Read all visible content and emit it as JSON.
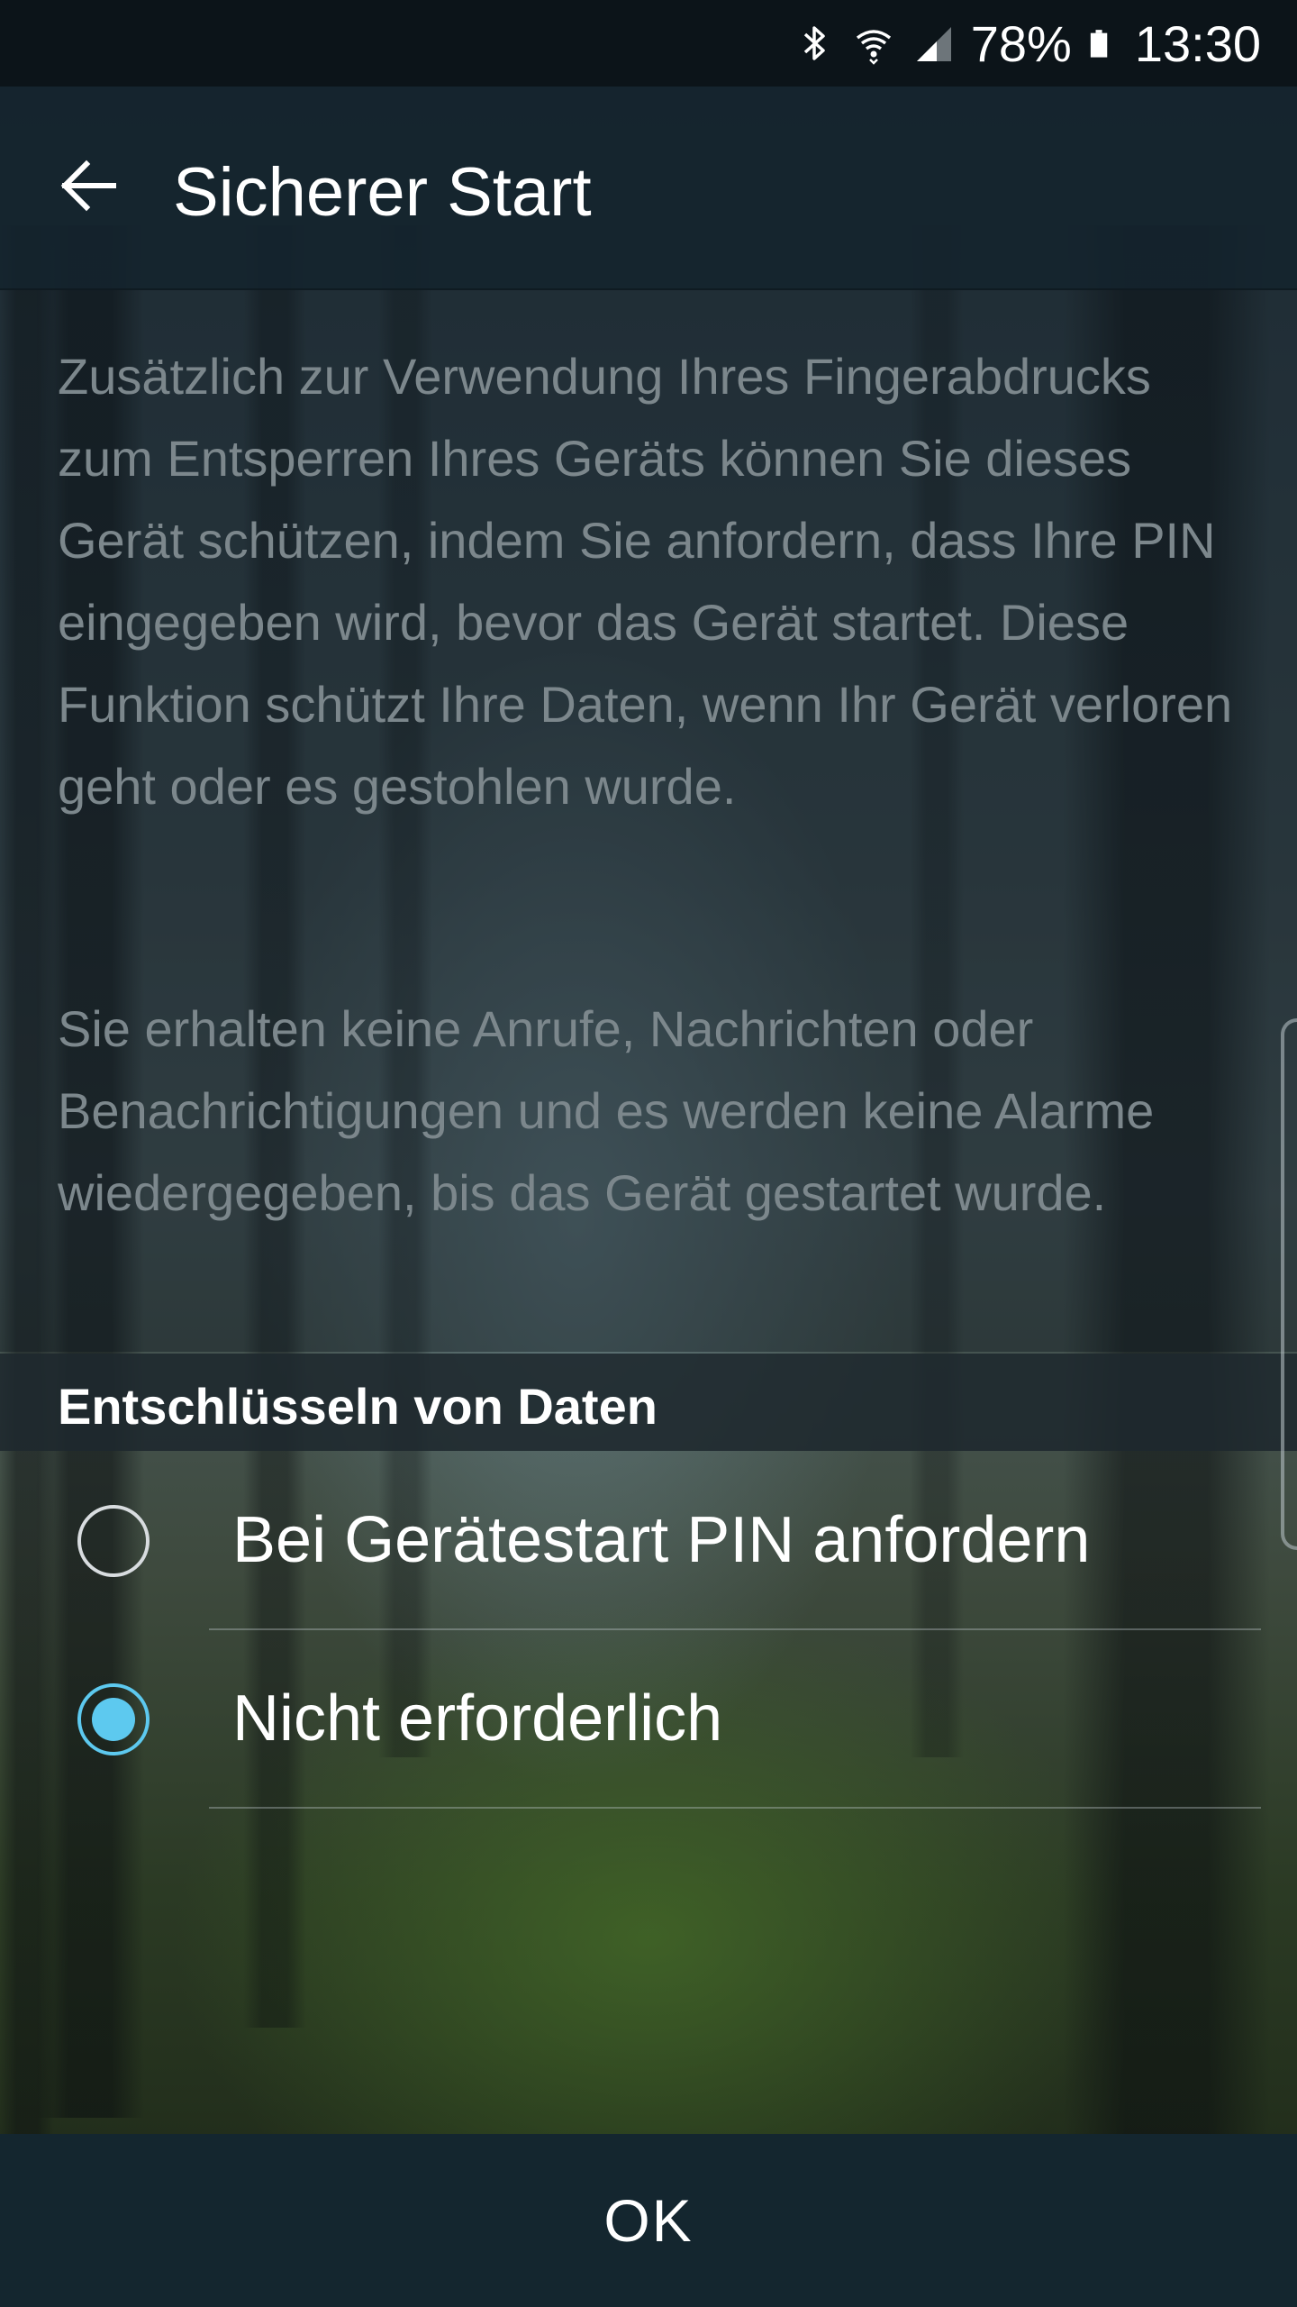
{
  "status_bar": {
    "icons": [
      "bluetooth-icon",
      "wifi-icon",
      "signal-icon",
      "battery-icon"
    ],
    "battery_percent": "78%",
    "time": "13:30"
  },
  "app_bar": {
    "back_icon": "arrow-left-icon",
    "title": "Sicherer Start"
  },
  "description": {
    "paragraph_1": "Zusätzlich zur Verwendung Ihres Fingerabdrucks zum Entsperren Ihres Geräts können Sie dieses Gerät schützen, indem Sie anfordern, dass Ihre PIN eingegeben wird, bevor das Gerät startet. Diese Funktion schützt Ihre Daten, wenn Ihr Gerät verloren geht oder es gestohlen wurde.",
    "paragraph_2": "Sie erhalten keine Anrufe, Nachrichten oder Benachrichtigungen und es werden keine Alarme wiedergegeben, bis das Gerät gestartet wurde."
  },
  "section": {
    "title": "Entschlüsseln von Daten"
  },
  "options": [
    {
      "label": "Bei Gerätestart PIN anfordern",
      "selected": false
    },
    {
      "label": "Nicht erforderlich",
      "selected": true
    }
  ],
  "footer": {
    "ok_label": "OK"
  },
  "colors": {
    "accent": "#5dc9ef",
    "app_bar": "#14232c",
    "bottom_bar": "#14262f",
    "description_text": "#7c878c"
  }
}
